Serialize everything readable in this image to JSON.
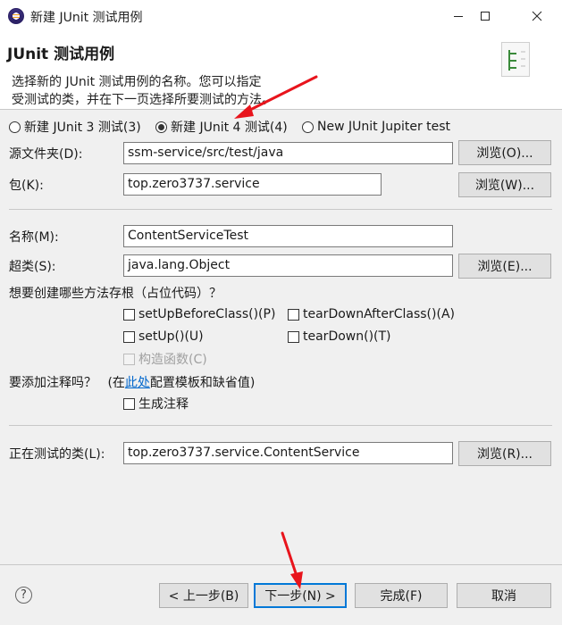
{
  "window": {
    "title": "新建 JUnit 测试用例"
  },
  "header": {
    "title": "JUnit 测试用例",
    "description_line1": "选择新的 JUnit 测试用例的名称。您可以指定",
    "description_line2": "受测试的类，并在下一页选择所要测试的方法。"
  },
  "versions": [
    {
      "label": "新建 JUnit 3 测试(3)",
      "checked": false
    },
    {
      "label": "新建 JUnit 4 测试(4)",
      "checked": true
    },
    {
      "label": "New JUnit Jupiter test",
      "checked": false
    }
  ],
  "form": {
    "source_folder": {
      "label": "源文件夹(D):",
      "value": "ssm-service/src/test/java",
      "browse": "浏览(O)..."
    },
    "package": {
      "label": "包(K):",
      "value": "top.zero3737.service",
      "browse": "浏览(W)..."
    },
    "name": {
      "label": "名称(M):",
      "value": "ContentServiceTest"
    },
    "superclass": {
      "label": "超类(S):",
      "value": "java.lang.Object",
      "browse": "浏览(E)..."
    },
    "stubs_question": "想要创建哪些方法存根（占位代码）？",
    "stubs": {
      "setUpBeforeClass": "setUpBeforeClass()(P)",
      "tearDownAfterClass": "tearDownAfterClass()(A)",
      "setUp": "setUp()(U)",
      "tearDown": "tearDown()(T)",
      "constructor": "构造函数(C)"
    },
    "comments_question": "要添加注释吗？",
    "comments_hint_before": "(在",
    "comments_hint_link": "此处",
    "comments_hint_after": "配置模板和缺省值)",
    "generate_comments": "生成注释",
    "class_under_test": {
      "label": "正在测试的类(L):",
      "value": "top.zero3737.service.ContentService",
      "browse": "浏览(R)..."
    }
  },
  "footer": {
    "help": "?",
    "back": "< 上一步(B)",
    "next": "下一步(N) >",
    "finish": "完成(F)",
    "cancel": "取消"
  },
  "colors": {
    "annotation_arrow": "#e8141c",
    "default_button_border": "#0078d7",
    "link": "#0066cc"
  },
  "icons": [
    "eclipse-icon",
    "minimize-icon",
    "maximize-icon",
    "close-icon",
    "junit-banner-icon",
    "help-icon"
  ]
}
